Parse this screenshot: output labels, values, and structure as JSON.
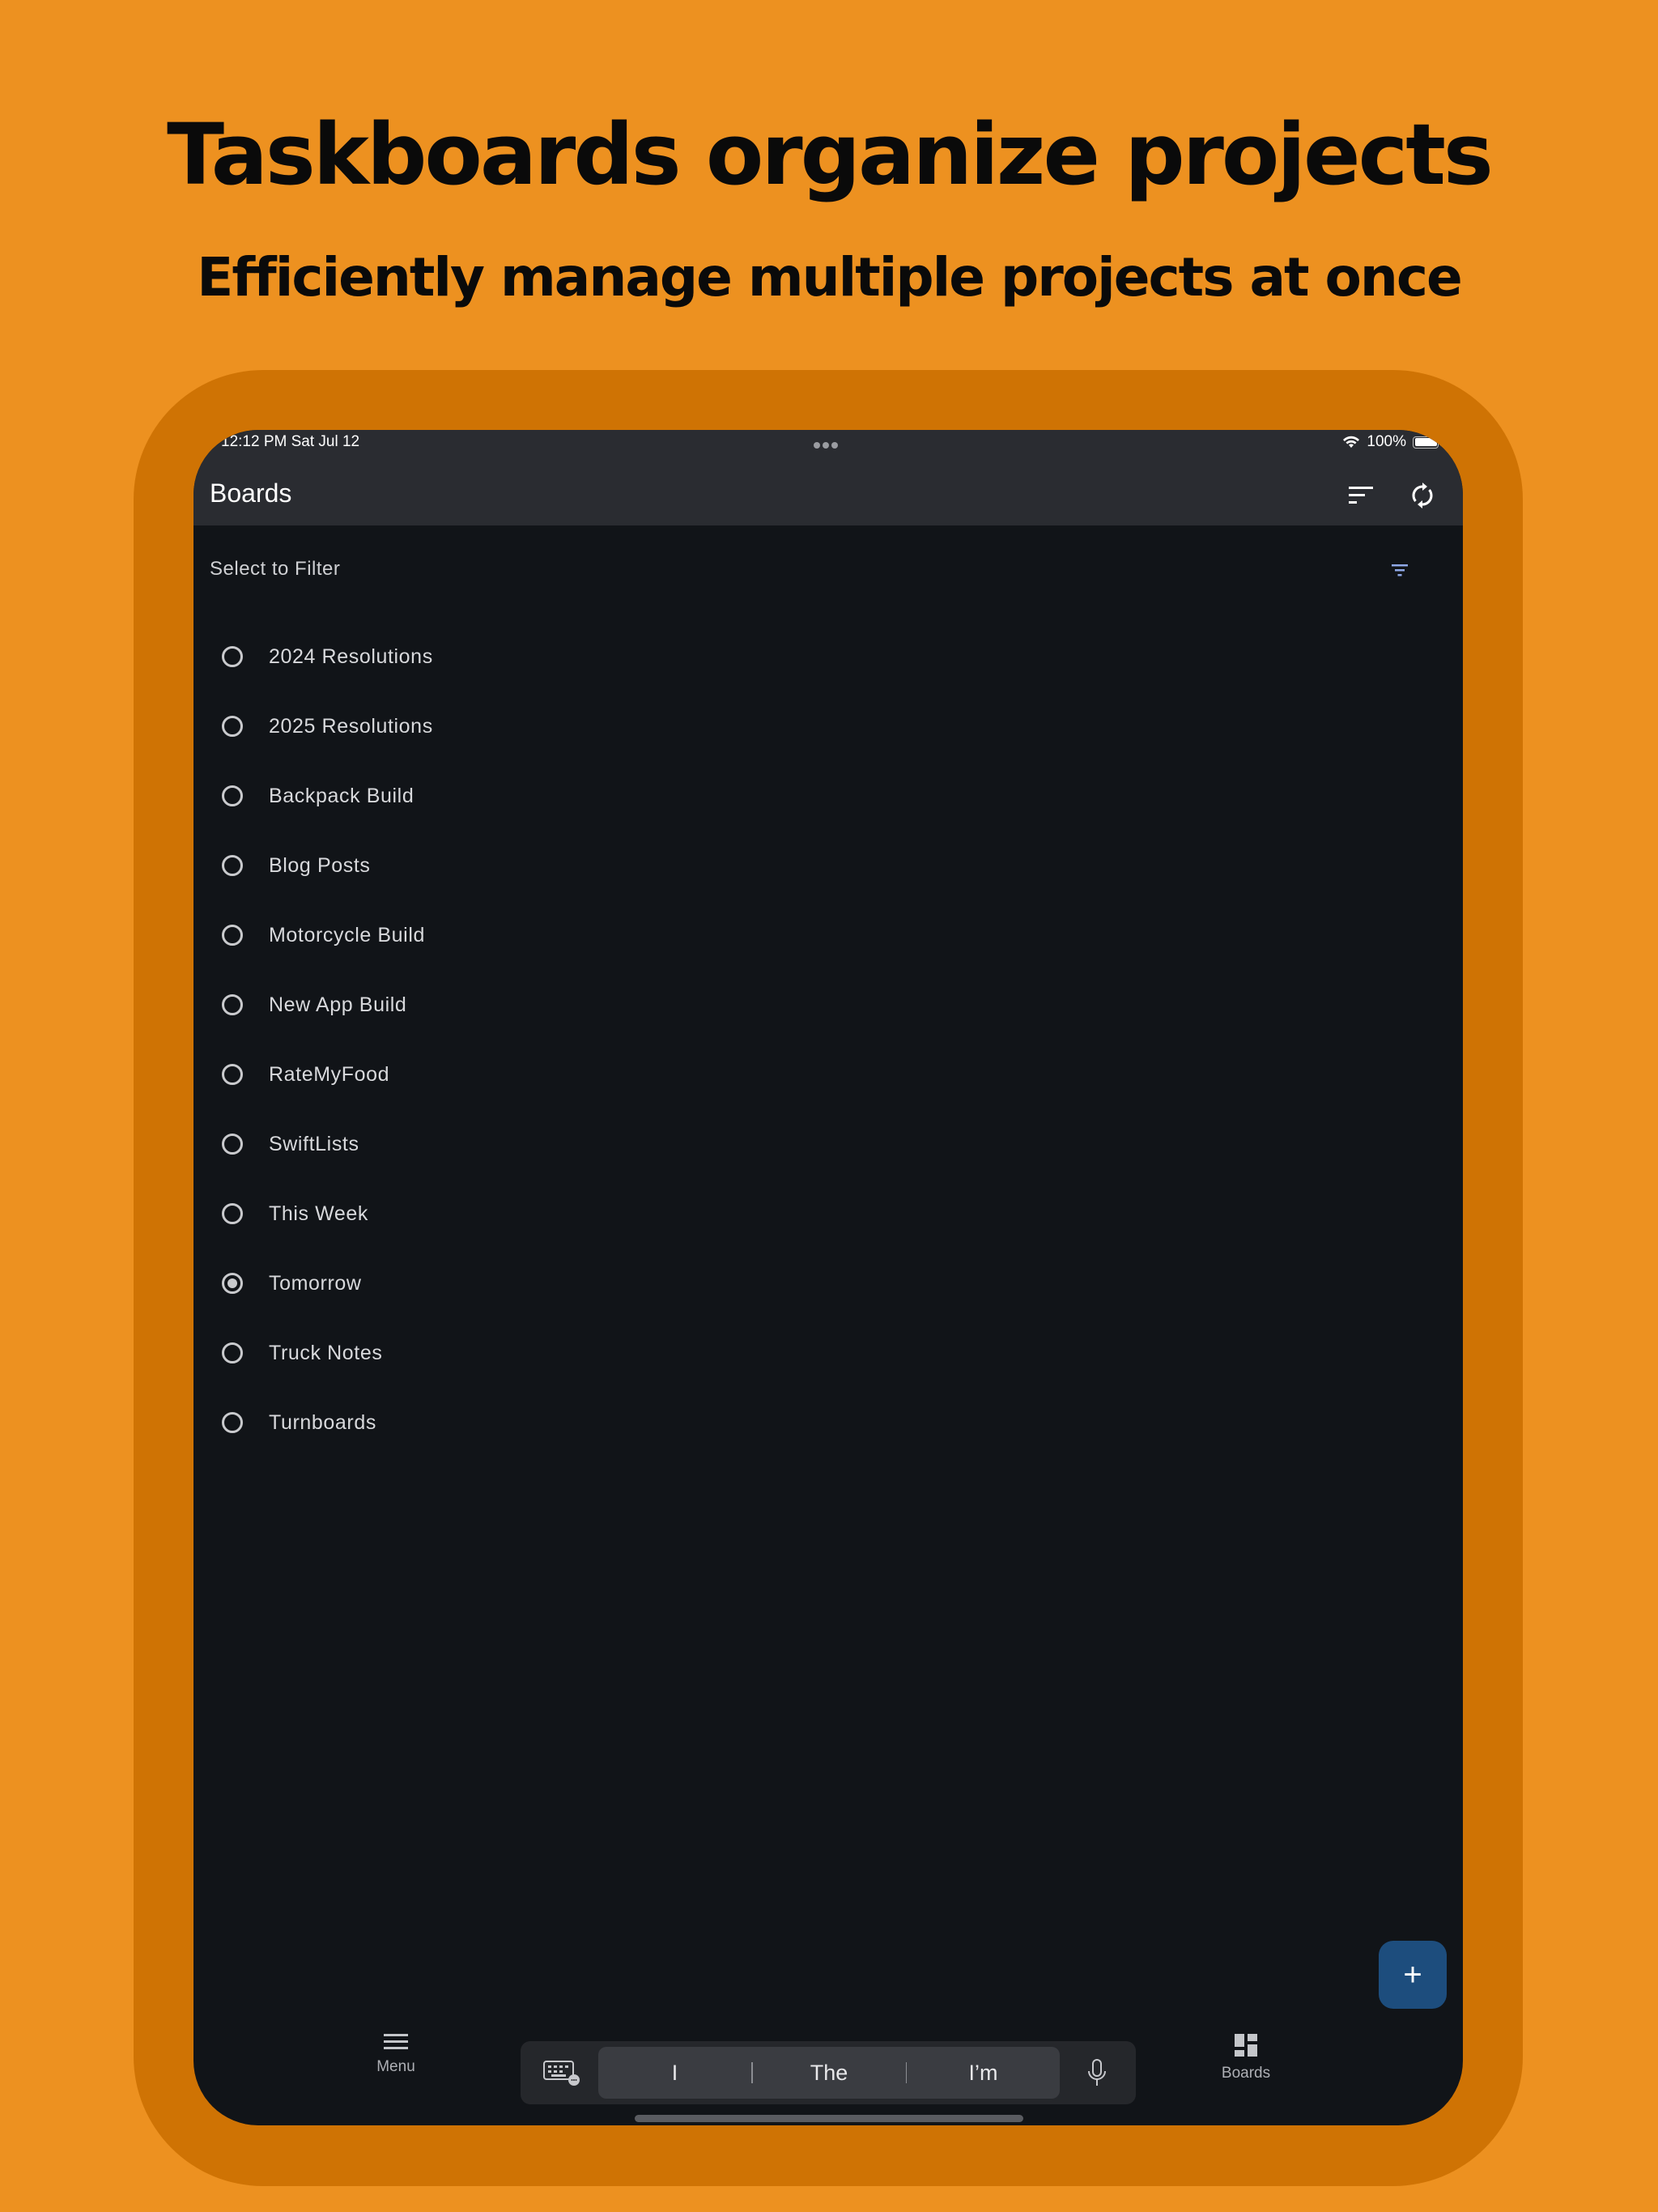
{
  "promo": {
    "headline": "Taskboards organize projects",
    "subheadline": "Efficiently manage multiple projects at once"
  },
  "colors": {
    "page_background": "#ed9120",
    "bezel": "#cf7304",
    "screen_background": "#111418",
    "appbar_background": "#2a2c31",
    "fab_background": "#1d4d7d",
    "filter_accent": "#8fa8e6"
  },
  "status_bar": {
    "time_date": "12:12 PM   Sat Jul 12",
    "battery": "100%"
  },
  "appbar": {
    "title": "Boards",
    "sort_icon": "sort-icon",
    "sync_icon": "sync-icon"
  },
  "filter": {
    "label": "Select to Filter",
    "icon": "filter-icon"
  },
  "boards": [
    {
      "label": "2024 Resolutions",
      "selected": false
    },
    {
      "label": "2025 Resolutions",
      "selected": false
    },
    {
      "label": "Backpack Build",
      "selected": false
    },
    {
      "label": "Blog Posts",
      "selected": false
    },
    {
      "label": "Motorcycle Build",
      "selected": false
    },
    {
      "label": "New App Build",
      "selected": false
    },
    {
      "label": "RateMyFood",
      "selected": false
    },
    {
      "label": "SwiftLists",
      "selected": false
    },
    {
      "label": "This Week",
      "selected": false
    },
    {
      "label": "Tomorrow",
      "selected": true
    },
    {
      "label": "Truck Notes",
      "selected": false
    },
    {
      "label": "Turnboards",
      "selected": false
    }
  ],
  "fab": {
    "label": "+"
  },
  "bottom_nav": {
    "menu_label": "Menu",
    "boards_label": "Boards"
  },
  "keyboard_bar": {
    "suggestions": [
      "I",
      "The",
      "I’m"
    ]
  }
}
